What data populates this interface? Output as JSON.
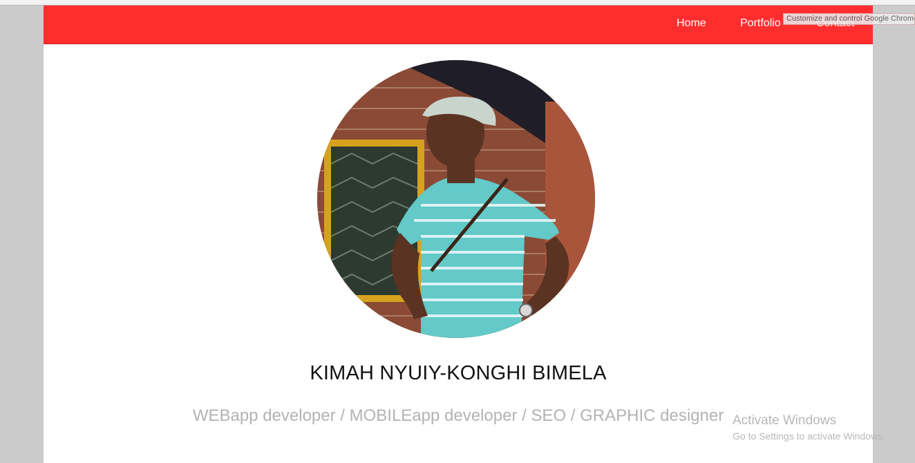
{
  "nav": {
    "items": [
      {
        "label": "Home"
      },
      {
        "label": "Portfolio"
      },
      {
        "label": "Contact"
      }
    ]
  },
  "tooltip": {
    "text": "Customize and control Google Chrome"
  },
  "profile": {
    "name": "KIMAH NYUIY-KONGHI BIMELA",
    "tagline": "WEBapp developer / MOBILEapp developer / SEO / GRAPHIC designer",
    "photo_icon": "profile-photo"
  },
  "watermark": {
    "title": "Activate Windows",
    "subtitle": "Go to Settings to activate Windows."
  },
  "colors": {
    "navbar": "#ff2e2e",
    "page_background": "#ffffff",
    "outer_background": "#cbcbcb",
    "tagline": "#b3b3b3"
  }
}
